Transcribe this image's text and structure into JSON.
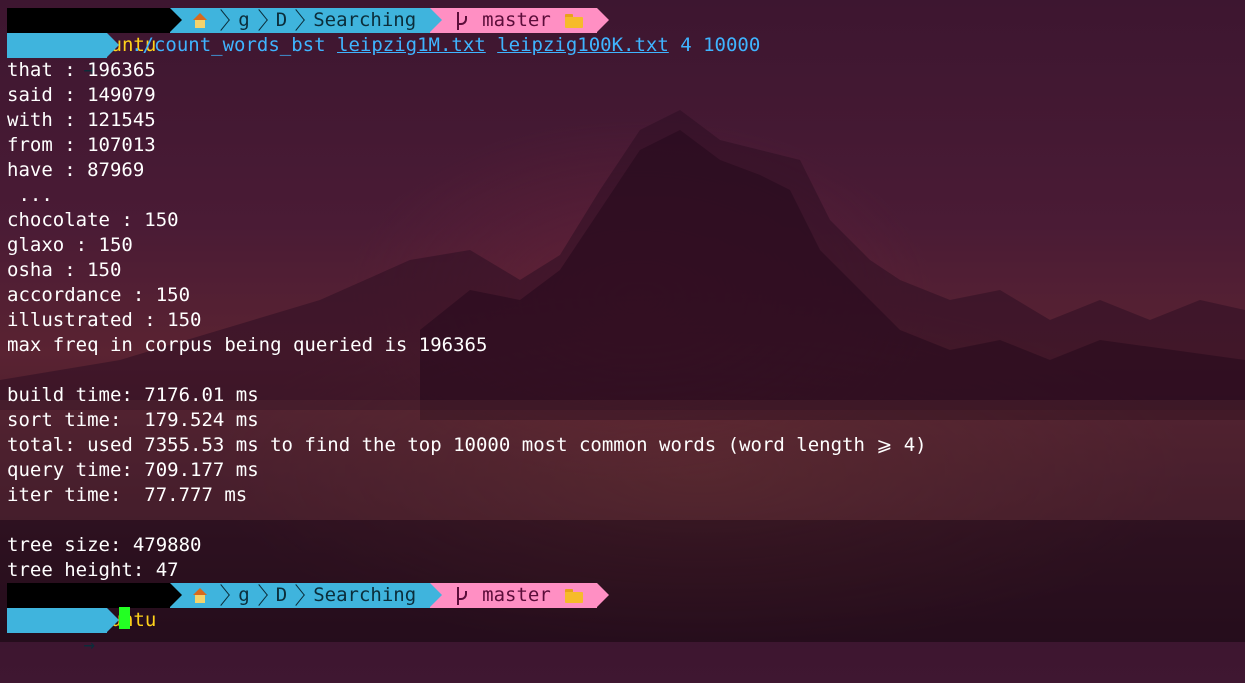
{
  "prompt": {
    "user": "ubuntu",
    "path_parts": [
      "g",
      "D",
      "Searching"
    ],
    "branch": "master",
    "symbol": "→",
    "icons": [
      "home-icon",
      "branch-icon",
      "folder-icon"
    ]
  },
  "command": {
    "program": "./count_words_bst",
    "arg1": "leipzig1M.txt",
    "arg2": "leipzig100K.txt",
    "rest": "4 10000"
  },
  "output_lines": [
    "that : 196365",
    "said : 149079",
    "with : 121545",
    "from : 107013",
    "have : 87969",
    " ...",
    "chocolate : 150",
    "glaxo : 150",
    "osha : 150",
    "accordance : 150",
    "illustrated : 150",
    "max freq in corpus being queried is 196365",
    "",
    "build time: 7176.01 ms",
    "sort time:  179.524 ms",
    "total: used 7355.53 ms to find the top 10000 most common words (word length ⩾ 4)",
    "query time: 709.177 ms",
    "iter time:  77.777 ms",
    "",
    "tree size: 479880",
    "tree height: 47"
  ],
  "colors": {
    "user_bg": "#000000",
    "user_fg": "#ffd21a",
    "path_bg": "#3fb4dd",
    "git_bg": "#ff8fc3",
    "command_fg": "#3fb4ff",
    "cursor": "#23ff23"
  }
}
